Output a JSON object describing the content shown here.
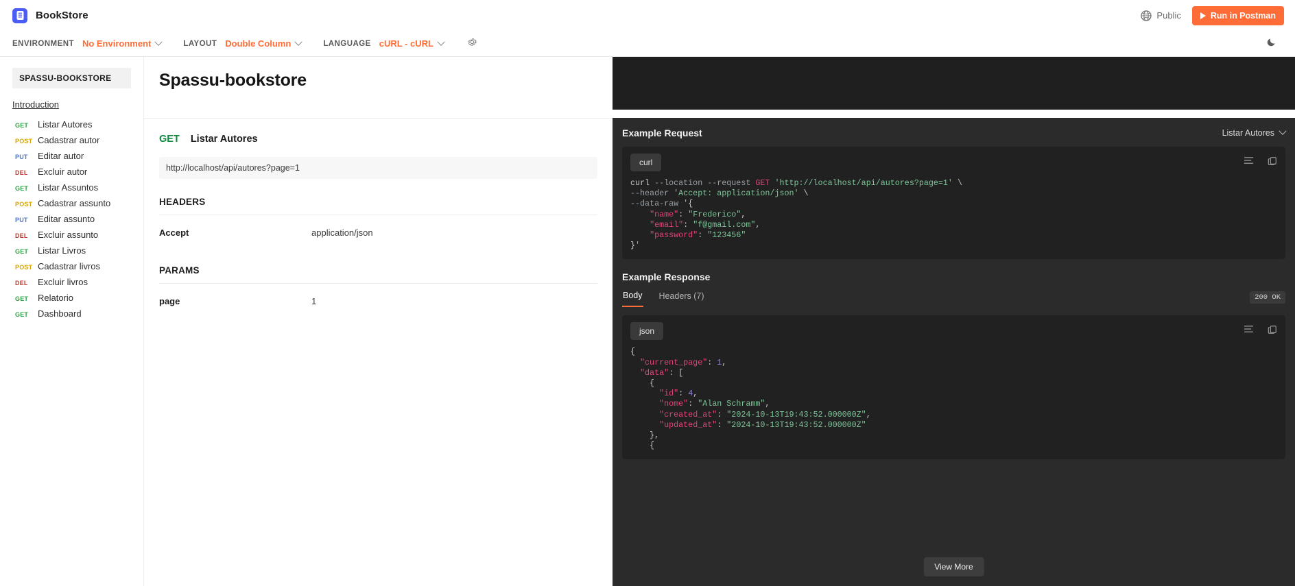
{
  "topbar": {
    "brand_name": "BookStore",
    "logo_icon": "book-logo-icon",
    "visibility_label": "Public",
    "globe_icon": "globe-icon",
    "run_button_label": "Run in Postman",
    "run_icon": "play-icon",
    "accent_color": "#ff6c37"
  },
  "subbar": {
    "environment_label": "ENVIRONMENT",
    "environment_value": "No Environment",
    "layout_label": "LAYOUT",
    "layout_value": "Double Column",
    "language_label": "LANGUAGE",
    "language_value": "cURL - cURL",
    "settings_icon": "gear-icon",
    "theme_icon": "moon-icon",
    "chevron_icon": "chevron-down-icon"
  },
  "sidebar": {
    "collection_title": "SPASSU-BOOKSTORE",
    "introduction_label": "Introduction",
    "items": [
      {
        "method": "GET",
        "label": "Listar Autores"
      },
      {
        "method": "POST",
        "label": "Cadastrar autor"
      },
      {
        "method": "PUT",
        "label": "Editar autor"
      },
      {
        "method": "DEL",
        "label": "Excluir autor"
      },
      {
        "method": "GET",
        "label": "Listar Assuntos"
      },
      {
        "method": "POST",
        "label": "Cadastrar assunto"
      },
      {
        "method": "PUT",
        "label": "Editar assunto"
      },
      {
        "method": "DEL",
        "label": "Excluir assunto"
      },
      {
        "method": "GET",
        "label": "Listar Livros"
      },
      {
        "method": "POST",
        "label": "Cadastrar livros"
      },
      {
        "method": "DEL",
        "label": "Excluir livros"
      },
      {
        "method": "GET",
        "label": "Relatorio"
      },
      {
        "method": "GET",
        "label": "Dashboard"
      }
    ]
  },
  "doc": {
    "page_title": "Spassu-bookstore",
    "request": {
      "method": "GET",
      "name": "Listar Autores",
      "url": "http://localhost/api/autores?page=1"
    },
    "headers_section": {
      "title": "HEADERS",
      "rows": [
        {
          "key": "Accept",
          "value": "application/json"
        }
      ]
    },
    "params_section": {
      "title": "PARAMS",
      "rows": [
        {
          "key": "page",
          "value": "1"
        }
      ]
    }
  },
  "example_request": {
    "title": "Example Request",
    "selected_example": "Listar Autores",
    "language_pill": "curl",
    "wrap_icon": "wrap-lines-icon",
    "copy_icon": "copy-icon",
    "code_lines": [
      {
        "segments": [
          {
            "t": "cmd",
            "v": "curl "
          },
          {
            "t": "flag",
            "v": "--location --request "
          },
          {
            "t": "method",
            "v": "GET "
          },
          {
            "t": "str",
            "v": "'http://localhost/api/autores?page=1'"
          },
          {
            "t": "cmd",
            "v": " \\"
          }
        ]
      },
      {
        "segments": [
          {
            "t": "flag",
            "v": "--header "
          },
          {
            "t": "str",
            "v": "'Accept: application/json'"
          },
          {
            "t": "cmd",
            "v": " \\"
          }
        ]
      },
      {
        "segments": [
          {
            "t": "flag",
            "v": "--data-raw "
          },
          {
            "t": "str",
            "v": "'"
          },
          {
            "t": "punct",
            "v": "{"
          }
        ]
      },
      {
        "segments": [
          {
            "t": "punct",
            "v": "    "
          },
          {
            "t": "key",
            "v": "\"name\""
          },
          {
            "t": "punct",
            "v": ": "
          },
          {
            "t": "str",
            "v": "\"Frederico\""
          },
          {
            "t": "punct",
            "v": ","
          }
        ]
      },
      {
        "segments": [
          {
            "t": "punct",
            "v": "    "
          },
          {
            "t": "key",
            "v": "\"email\""
          },
          {
            "t": "punct",
            "v": ": "
          },
          {
            "t": "str",
            "v": "\"f@gmail.com\""
          },
          {
            "t": "punct",
            "v": ","
          }
        ]
      },
      {
        "segments": [
          {
            "t": "punct",
            "v": "    "
          },
          {
            "t": "key",
            "v": "\"password\""
          },
          {
            "t": "punct",
            "v": ": "
          },
          {
            "t": "str",
            "v": "\"123456\""
          }
        ]
      },
      {
        "segments": [
          {
            "t": "punct",
            "v": "}"
          },
          {
            "t": "str",
            "v": "'"
          }
        ]
      }
    ]
  },
  "example_response": {
    "title": "Example Response",
    "tabs": [
      {
        "label": "Body",
        "active": true
      },
      {
        "label": "Headers (7)",
        "active": false
      }
    ],
    "status": "200 OK",
    "language_pill": "json",
    "wrap_icon": "wrap-lines-icon",
    "copy_icon": "copy-icon",
    "view_more_label": "View More",
    "code_lines": [
      {
        "segments": [
          {
            "t": "punct",
            "v": "{"
          }
        ]
      },
      {
        "segments": [
          {
            "t": "punct",
            "v": "  "
          },
          {
            "t": "key",
            "v": "\"current_page\""
          },
          {
            "t": "punct",
            "v": ": "
          },
          {
            "t": "num",
            "v": "1"
          },
          {
            "t": "punct",
            "v": ","
          }
        ]
      },
      {
        "segments": [
          {
            "t": "punct",
            "v": "  "
          },
          {
            "t": "key",
            "v": "\"data\""
          },
          {
            "t": "punct",
            "v": ": ["
          }
        ]
      },
      {
        "segments": [
          {
            "t": "punct",
            "v": "    {"
          }
        ]
      },
      {
        "segments": [
          {
            "t": "punct",
            "v": "      "
          },
          {
            "t": "key",
            "v": "\"id\""
          },
          {
            "t": "punct",
            "v": ": "
          },
          {
            "t": "num",
            "v": "4"
          },
          {
            "t": "punct",
            "v": ","
          }
        ]
      },
      {
        "segments": [
          {
            "t": "punct",
            "v": "      "
          },
          {
            "t": "key",
            "v": "\"nome\""
          },
          {
            "t": "punct",
            "v": ": "
          },
          {
            "t": "str",
            "v": "\"Alan Schramm\""
          },
          {
            "t": "punct",
            "v": ","
          }
        ]
      },
      {
        "segments": [
          {
            "t": "punct",
            "v": "      "
          },
          {
            "t": "key",
            "v": "\"created_at\""
          },
          {
            "t": "punct",
            "v": ": "
          },
          {
            "t": "str",
            "v": "\"2024-10-13T19:43:52.000000Z\""
          },
          {
            "t": "punct",
            "v": ","
          }
        ]
      },
      {
        "segments": [
          {
            "t": "punct",
            "v": "      "
          },
          {
            "t": "key",
            "v": "\"updated_at\""
          },
          {
            "t": "punct",
            "v": ": "
          },
          {
            "t": "str",
            "v": "\"2024-10-13T19:43:52.000000Z\""
          }
        ]
      },
      {
        "segments": [
          {
            "t": "punct",
            "v": "    },"
          }
        ]
      },
      {
        "segments": [
          {
            "t": "punct",
            "v": "    {"
          }
        ]
      }
    ]
  }
}
